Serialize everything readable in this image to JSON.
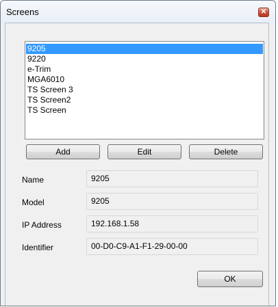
{
  "window": {
    "title": "Screens",
    "close_glyph": "✕"
  },
  "screens_list": {
    "items": [
      "9205",
      "9220",
      "e-Trim",
      "MGA6010",
      "TS Screen 3",
      "TS Screen2",
      "TS Screen"
    ],
    "selected": "9205"
  },
  "buttons": {
    "add": "Add",
    "edit": "Edit",
    "delete": "Delete",
    "ok": "OK"
  },
  "fields": {
    "name": {
      "label": "Name",
      "value": "9205"
    },
    "model": {
      "label": "Model",
      "value": "9205"
    },
    "ip_address": {
      "label": "IP Address",
      "value": "192.168.1.58"
    },
    "identifier": {
      "label": "Identifier",
      "value": "00-D0-C9-A1-F1-29-00-00"
    }
  },
  "colors": {
    "selection": "#3399ff",
    "window_bg": "#f0f0f0",
    "close_button": "#c7503a"
  }
}
